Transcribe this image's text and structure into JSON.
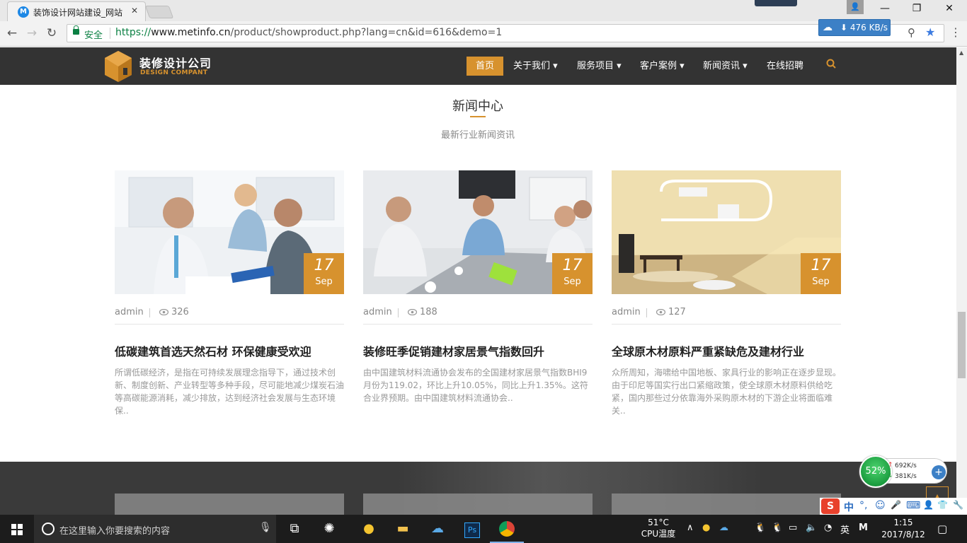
{
  "browser": {
    "tab_title": "装饰设计网站建设_网站",
    "tab_favicon": "M",
    "secure_label": "安全",
    "url_scheme": "https://",
    "url_host": "www.metinfo.cn",
    "url_path": "/product/showproduct.php?lang=cn&id=616&demo=1",
    "speed": "476 KB/s",
    "icons": [
      "back-icon",
      "forward-icon",
      "reload-icon",
      "lock-icon",
      "zoom-icon",
      "star-icon",
      "menu-icon",
      "user-icon"
    ]
  },
  "site": {
    "logo_cn": "装修设计公司",
    "logo_en": "DESIGN COMPANT",
    "nav": [
      {
        "label": "首页",
        "active": true
      },
      {
        "label": "关于我们 ▾"
      },
      {
        "label": "服务项目 ▾"
      },
      {
        "label": "客户案例 ▾"
      },
      {
        "label": "新闻资讯 ▾"
      },
      {
        "label": "在线招聘"
      }
    ],
    "accent": "#d7922e"
  },
  "news": {
    "title": "新闻中心",
    "subtitle": "最新行业新闻资讯",
    "items": [
      {
        "day": "17",
        "month": "Sep",
        "author": "admin",
        "views": "326",
        "title": "低碳建筑首选天然石材 环保健康受欢迎",
        "desc": "所谓低碳经济，是指在可持续发展理念指导下，通过技术创新、制度创新、产业转型等多种手段，尽可能地减少煤炭石油等高碳能源消耗，减少排放，达到经济社会发展与生态环境保.."
      },
      {
        "day": "17",
        "month": "Sep",
        "author": "admin",
        "views": "188",
        "title": "装修旺季促销建材家居景气指数回升",
        "desc": "由中国建筑材料流通协会发布的全国建材家居景气指数BHI9月份为119.02，环比上升10.05%，同比上升1.35%。这符合业界预期。由中国建筑材料流通协会.."
      },
      {
        "day": "17",
        "month": "Sep",
        "author": "admin",
        "views": "127",
        "title": "全球原木材原料严重紧缺危及建材行业",
        "desc": "众所周知，海啸给中国地板、家具行业的影响正在逐步显现。由于印尼等国实行出口紧缩政策，使全球原木材原料供给吃紧，国内那些过分依靠海外采购原木材的下游企业将面临难关.."
      }
    ]
  },
  "float_widget": {
    "cpu_percent": "52%",
    "up": "692K/s",
    "down": "381K/s"
  },
  "ime": {
    "logo": "S",
    "items": [
      "中",
      "°,",
      "☺",
      "🎤",
      "⌨",
      "👤",
      "👕",
      "🔧"
    ]
  },
  "taskbar": {
    "search_placeholder": "在这里输入你要搜索的内容",
    "temp": "51°C",
    "temp_label": "CPU温度",
    "lang": "英",
    "time": "1:15",
    "date": "2017/8/12"
  }
}
